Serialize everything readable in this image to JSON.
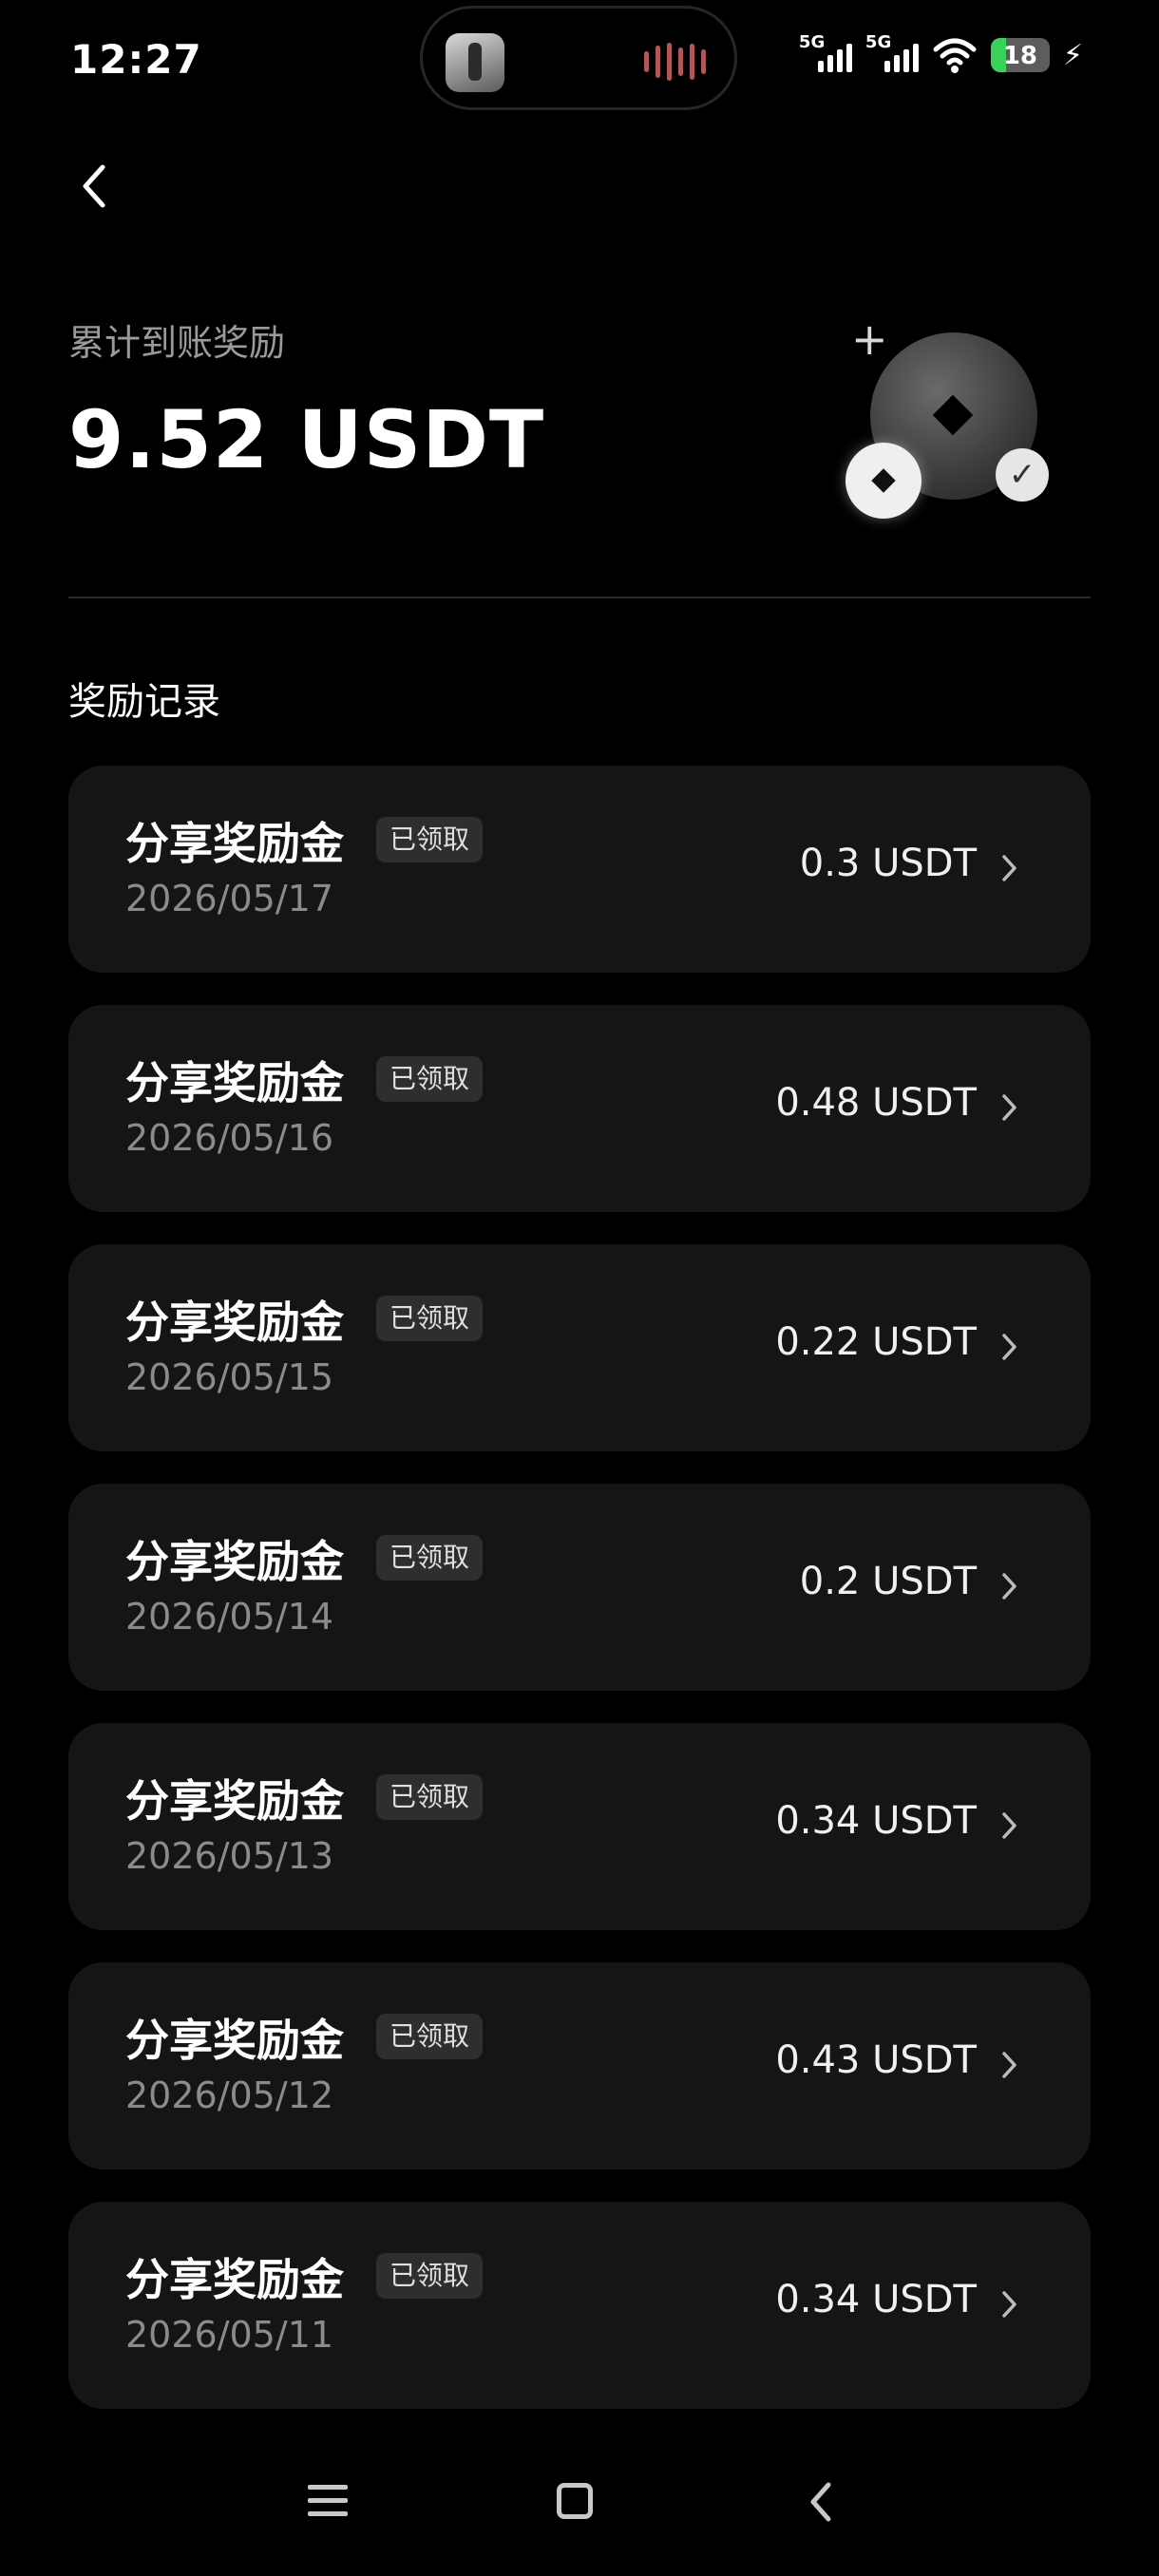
{
  "status_bar": {
    "time": "12:27",
    "signal1_label": "5G",
    "signal2_label": "5G",
    "battery_level": "18",
    "icons": [
      "app-thumbnail-icon",
      "audio-wave-icon",
      "signal-icon",
      "wifi-icon",
      "battery-icon",
      "charging-bolt-icon"
    ]
  },
  "header": {
    "back_icon": "chevron-left-icon"
  },
  "summary": {
    "label": "累计到账奖励",
    "amount": "9.52 USDT"
  },
  "records": {
    "title": "奖励记录",
    "items": [
      {
        "title": "分享奖励金",
        "badge": "已领取",
        "date": "2026/05/17",
        "amount": "0.3 USDT"
      },
      {
        "title": "分享奖励金",
        "badge": "已领取",
        "date": "2026/05/16",
        "amount": "0.48 USDT"
      },
      {
        "title": "分享奖励金",
        "badge": "已领取",
        "date": "2026/05/15",
        "amount": "0.22 USDT"
      },
      {
        "title": "分享奖励金",
        "badge": "已领取",
        "date": "2026/05/14",
        "amount": "0.2 USDT"
      },
      {
        "title": "分享奖励金",
        "badge": "已领取",
        "date": "2026/05/13",
        "amount": "0.34 USDT"
      },
      {
        "title": "分享奖励金",
        "badge": "已领取",
        "date": "2026/05/12",
        "amount": "0.43 USDT"
      },
      {
        "title": "分享奖励金",
        "badge": "已领取",
        "date": "2026/05/11",
        "amount": "0.34 USDT"
      }
    ]
  },
  "nav": {
    "icons": [
      "menu-icon",
      "home-icon",
      "back-icon"
    ]
  },
  "colors": {
    "background": "#000000",
    "card": "#151515",
    "badge": "#2e2e2e",
    "muted_text": "#8b8b8b",
    "battery_fill": "#3ad35a"
  }
}
